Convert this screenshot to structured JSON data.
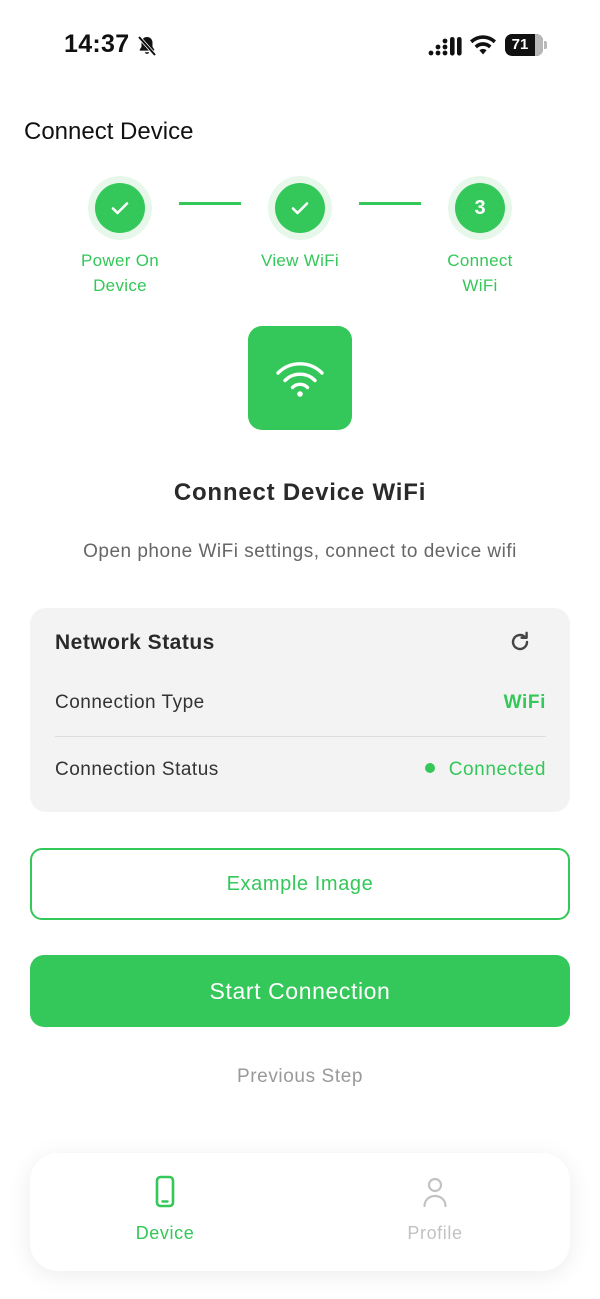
{
  "status_bar": {
    "time": "14:37",
    "battery_percent": "71",
    "icons": [
      "bell-slash-icon",
      "cellular-signal-icon",
      "wifi-signal-icon",
      "battery-icon"
    ]
  },
  "page": {
    "title": "Connect Device"
  },
  "stepper": {
    "steps": [
      {
        "label_line1": "Power On",
        "label_line2": "Device",
        "state": "done",
        "icon": "check-icon"
      },
      {
        "label_line1": "View WiFi",
        "label_line2": "",
        "state": "done",
        "icon": "check-icon"
      },
      {
        "label_line1": "Connect",
        "label_line2": "WiFi",
        "state": "current",
        "number": "3"
      }
    ]
  },
  "hero": {
    "icon": "wifi-icon",
    "heading": "Connect Device WiFi",
    "subtext": "Open phone WiFi settings, connect to device wifi"
  },
  "network_card": {
    "title": "Network Status",
    "refresh_icon": "refresh-icon",
    "rows": [
      {
        "label": "Connection Type",
        "value": "WiFi"
      },
      {
        "label": "Connection Status",
        "value": "Connected"
      }
    ]
  },
  "actions": {
    "example_image": "Example Image",
    "start_connection": "Start Connection",
    "previous_step": "Previous Step"
  },
  "tabbar": {
    "tabs": [
      {
        "label": "Device",
        "icon": "phone-icon",
        "active": true
      },
      {
        "label": "Profile",
        "icon": "person-icon",
        "active": false
      }
    ]
  },
  "colors": {
    "accent": "#34c759",
    "accent_halo": "#e7f7ea",
    "card_bg": "#f3f3f3",
    "muted_text": "#999999",
    "inactive_tab": "#c2c2c2"
  }
}
